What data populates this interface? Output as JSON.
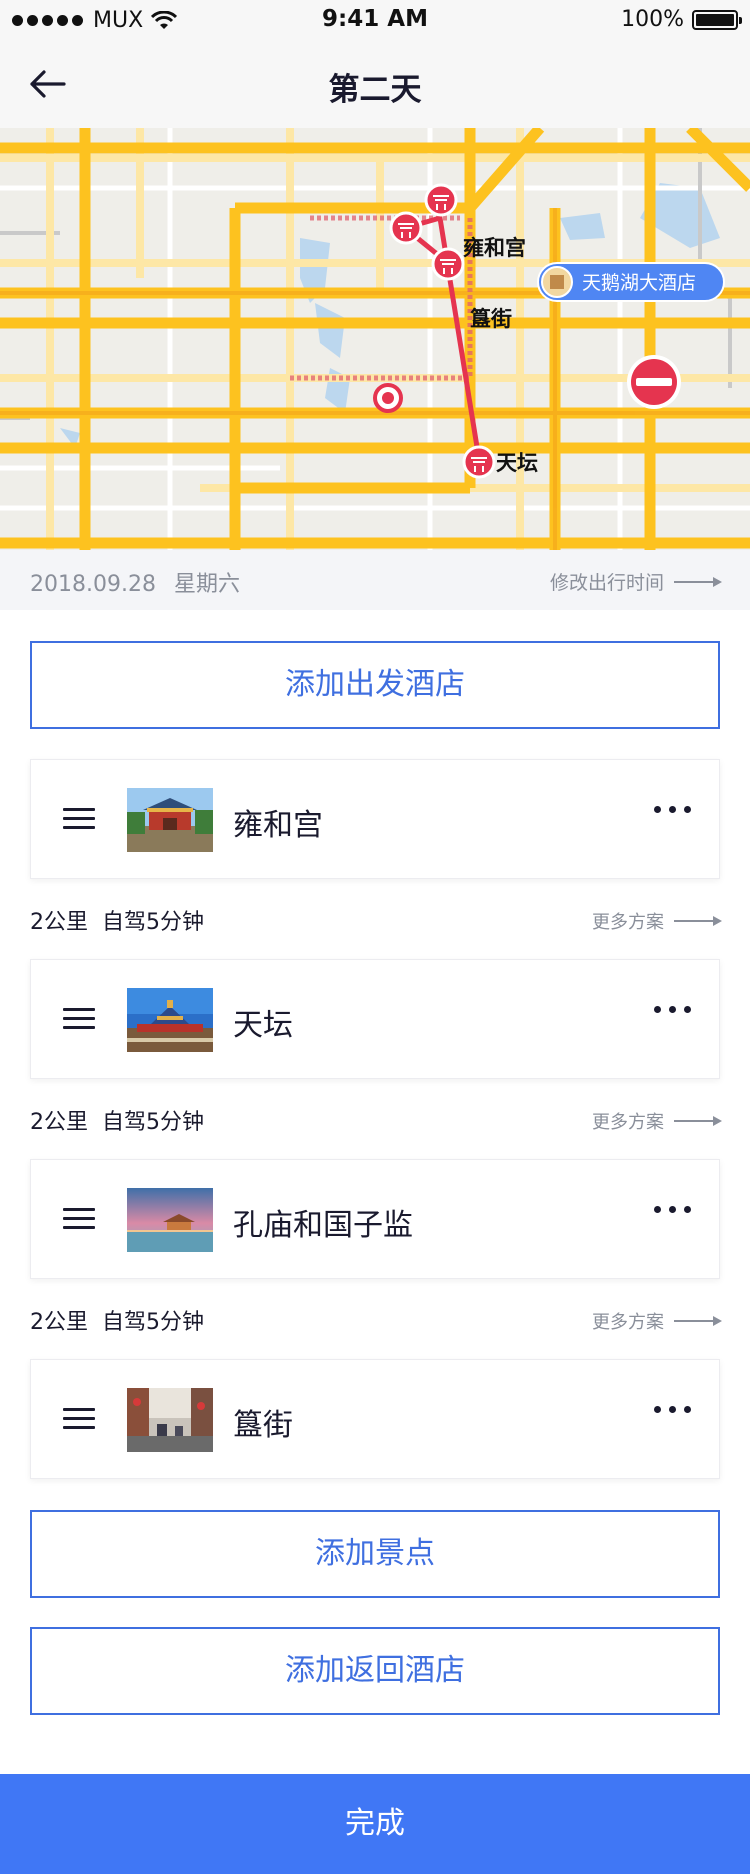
{
  "status_bar": {
    "carrier": "MUX",
    "time": "9:41 AM",
    "battery": "100%"
  },
  "nav": {
    "title": "第二天"
  },
  "map": {
    "pois": [
      {
        "name": "雍和宫",
        "kind": "temple-marker"
      },
      {
        "name": "簋街",
        "kind": "temple-marker"
      },
      {
        "name": "天坛",
        "kind": "temple-marker"
      }
    ],
    "hotel_label": "天鹅湖大酒店"
  },
  "date_row": {
    "date": "2018.09.28",
    "weekday": "星期六",
    "modify_label": "修改出行时间"
  },
  "buttons": {
    "add_departure_hotel": "添加出发酒店",
    "add_spot": "添加景点",
    "add_return_hotel": "添加返回酒店",
    "done": "完成"
  },
  "spots": [
    {
      "name": "雍和宫"
    },
    {
      "name": "天坛"
    },
    {
      "name": "孔庙和国子监"
    },
    {
      "name": "簋街"
    }
  ],
  "routes": [
    {
      "distance": "2公里",
      "mode": "自驾5分钟",
      "more": "更多方案"
    },
    {
      "distance": "2公里",
      "mode": "自驾5分钟",
      "more": "更多方案"
    },
    {
      "distance": "2公里",
      "mode": "自驾5分钟",
      "more": "更多方案"
    }
  ],
  "colors": {
    "accent": "#3f6fe0",
    "done_button": "#4077f5",
    "route_line": "#e5344f",
    "road": "#fdc21f"
  }
}
